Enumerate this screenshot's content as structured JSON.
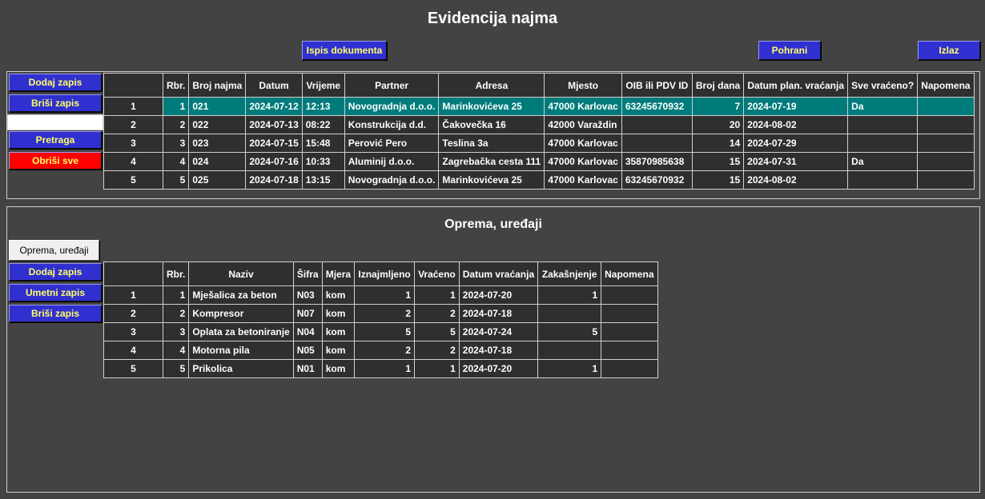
{
  "header": {
    "title": "Evidencija najma",
    "print_label": "Ispis dokumenta",
    "save_label": "Pohrani",
    "exit_label": "Izlaz"
  },
  "rental": {
    "add_label": "Dodaj zapis",
    "delete_label": "Briši zapis",
    "search_value": "",
    "search_label": "Pretraga",
    "clear_all_label": "Obriši sve",
    "columns": [
      "",
      "Rbr.",
      "Broj najma",
      "Datum",
      "Vrijeme",
      "Partner",
      "Adresa",
      "Mjesto",
      "OIB ili PDV ID",
      "Broj dana",
      "Datum plan. vraćanja",
      "Sve vraćeno?",
      "Napomena"
    ],
    "rows": [
      [
        "1",
        "1",
        "021",
        "2024-07-12",
        "12:13",
        "Novogradnja d.o.o.",
        "Marinkovićeva 25",
        "47000 Karlovac",
        "63245670932",
        "7",
        "2024-07-19",
        "Da",
        ""
      ],
      [
        "2",
        "2",
        "022",
        "2024-07-13",
        "08:22",
        "Konstrukcija d.d.",
        "Čakovečka 16",
        "42000 Varaždin",
        "",
        "20",
        "2024-08-02",
        "",
        ""
      ],
      [
        "3",
        "3",
        "023",
        "2024-07-15",
        "15:48",
        "Perović Pero",
        "Teslina 3a",
        "47000 Karlovac",
        "",
        "14",
        "2024-07-29",
        "",
        ""
      ],
      [
        "4",
        "4",
        "024",
        "2024-07-16",
        "10:33",
        "Aluminij d.o.o.",
        "Zagrebačka cesta 111",
        "47000 Karlovac",
        "35870985638",
        "15",
        "2024-07-31",
        "Da",
        ""
      ],
      [
        "5",
        "5",
        "025",
        "2024-07-18",
        "13:15",
        "Novogradnja d.o.o.",
        "Marinkovićeva 25",
        "47000 Karlovac",
        "63245670932",
        "15",
        "2024-08-02",
        "",
        ""
      ]
    ]
  },
  "equipment": {
    "title": "Oprema, uređaji",
    "tab_label": "Oprema, uređaji",
    "add_label": "Dodaj zapis",
    "insert_label": "Umetni zapis",
    "delete_label": "Briši zapis",
    "columns": [
      "",
      "Rbr.",
      "Naziv",
      "Šifra",
      "Mjera",
      "Iznajmljeno",
      "Vraćeno",
      "Datum vraćanja",
      "Zakašnjenje",
      "Napomena"
    ],
    "rows": [
      [
        "1",
        "1",
        "Mješalica za beton",
        "N03",
        "kom",
        "1",
        "1",
        "2024-07-20",
        "1",
        ""
      ],
      [
        "2",
        "2",
        "Kompresor",
        "N07",
        "kom",
        "2",
        "2",
        "2024-07-18",
        "",
        ""
      ],
      [
        "3",
        "3",
        "Oplata za betoniranje",
        "N04",
        "kom",
        "5",
        "5",
        "2024-07-24",
        "5",
        ""
      ],
      [
        "4",
        "4",
        "Motorna pila",
        "N05",
        "kom",
        "2",
        "2",
        "2024-07-18",
        "",
        ""
      ],
      [
        "5",
        "5",
        "Prikolica",
        "N01",
        "kom",
        "1",
        "1",
        "2024-07-20",
        "1",
        ""
      ]
    ]
  }
}
